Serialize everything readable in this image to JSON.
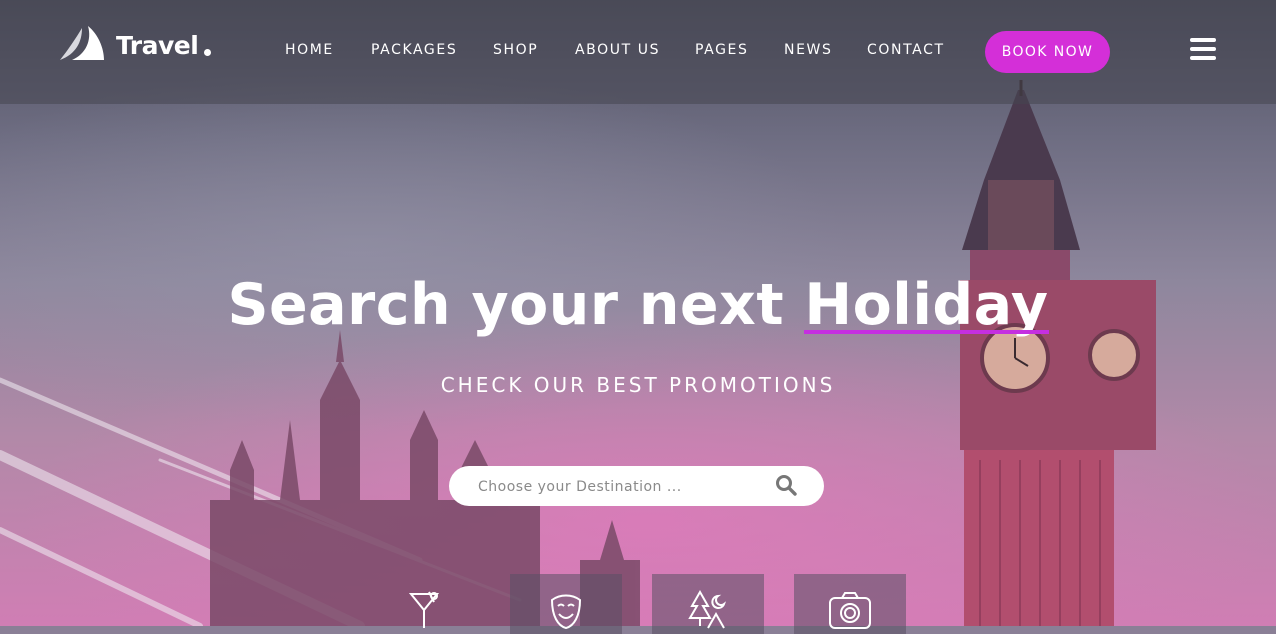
{
  "header": {
    "logo_text": "Travel",
    "nav": [
      "HOME",
      "PACKAGES",
      "SHOP",
      "ABOUT US",
      "PAGES",
      "NEWS",
      "CONTACT"
    ],
    "book_label": "BOOK NOW"
  },
  "hero": {
    "headline_prefix": "Search your next ",
    "headline_highlight": "Holiday",
    "subline": "CHECK OUR BEST PROMOTIONS",
    "search_placeholder": "Choose your Destination ..."
  },
  "categories": [
    {
      "icon": "cocktail-icon"
    },
    {
      "icon": "theater-mask-icon"
    },
    {
      "icon": "camping-icon"
    },
    {
      "icon": "camera-icon"
    }
  ],
  "colors": {
    "accent": "#d42fd8",
    "header_bg": "rgba(70,70,80,0.55)"
  }
}
